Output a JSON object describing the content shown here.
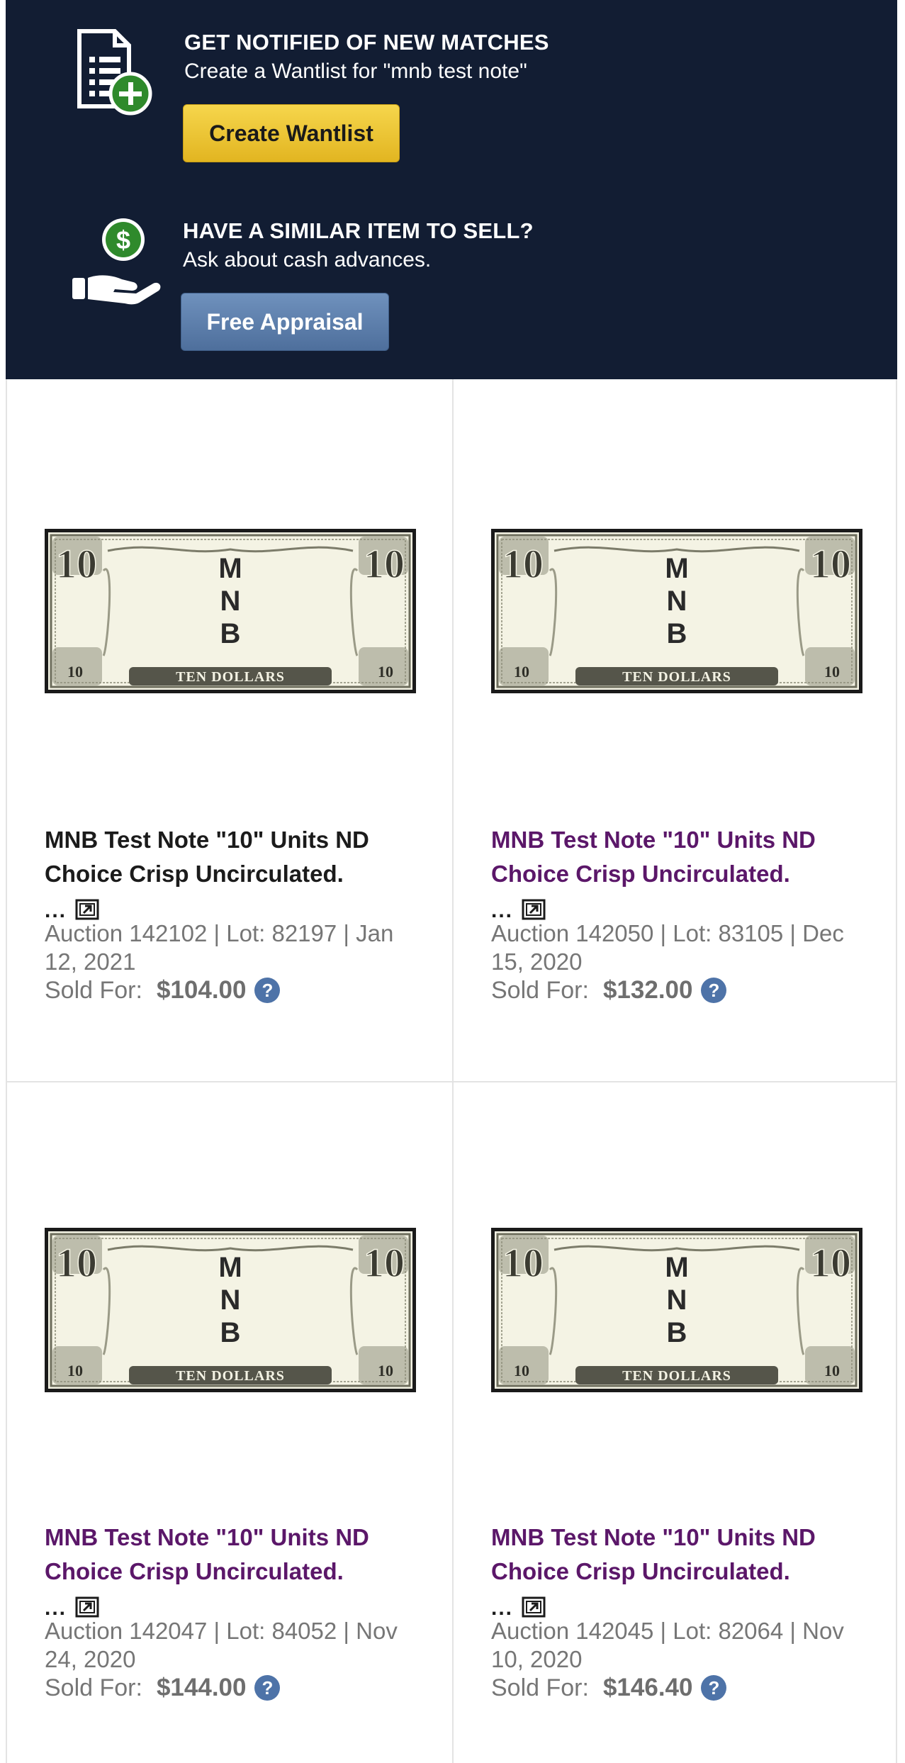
{
  "wantlist": {
    "title": "GET NOTIFIED OF NEW MATCHES",
    "subtitle": "Create a Wantlist for \"mnb test note\"",
    "button_label": "Create Wantlist",
    "icon": "document-add-icon"
  },
  "appraisal": {
    "title": "HAVE A SIMILAR ITEM TO SELL?",
    "subtitle": "Ask about cash advances.",
    "button_label": "Free Appraisal",
    "icon": "hand-dollar-icon"
  },
  "colors": {
    "panel_bg": "#121d33",
    "yellow_button": "#edc535",
    "blue_button": "#5e80ae",
    "visited_link": "#5b1769",
    "help_icon": "#4e73a8"
  },
  "results": [
    {
      "title": "MNB Test Note \"10\" Units ND Choice Crisp Uncirculated.",
      "ellipsis": "...",
      "meta": "Auction 142102 | Lot: 82197 | Jan 12, 2021",
      "sold_label": "Sold For:",
      "price": "$104.00",
      "image": {
        "digit": "10",
        "letters": [
          "M",
          "N",
          "B"
        ],
        "denomination": "TEN DOLLARS"
      }
    },
    {
      "title": "MNB Test Note \"10\" Units ND Choice Crisp Uncirculated.",
      "ellipsis": "...",
      "meta": "Auction 142050 | Lot: 83105 | Dec 15, 2020",
      "sold_label": "Sold For:",
      "price": "$132.00",
      "image": {
        "digit": "10",
        "letters": [
          "M",
          "N",
          "B"
        ],
        "denomination": "TEN DOLLARS"
      }
    },
    {
      "title": "MNB Test Note \"10\" Units ND Choice Crisp Uncirculated.",
      "ellipsis": "...",
      "meta": "Auction 142047 | Lot: 84052 | Nov 24, 2020",
      "sold_label": "Sold For:",
      "price": "$144.00",
      "image": {
        "digit": "10",
        "letters": [
          "M",
          "N",
          "B"
        ],
        "denomination": "TEN DOLLARS"
      }
    },
    {
      "title": "MNB Test Note \"10\" Units ND Choice Crisp Uncirculated.",
      "ellipsis": "...",
      "meta": "Auction 142045 | Lot: 82064 | Nov 10, 2020",
      "sold_label": "Sold For:",
      "price": "$146.40",
      "image": {
        "digit": "10",
        "letters": [
          "M",
          "N",
          "B"
        ],
        "denomination": "TEN DOLLARS"
      }
    }
  ]
}
